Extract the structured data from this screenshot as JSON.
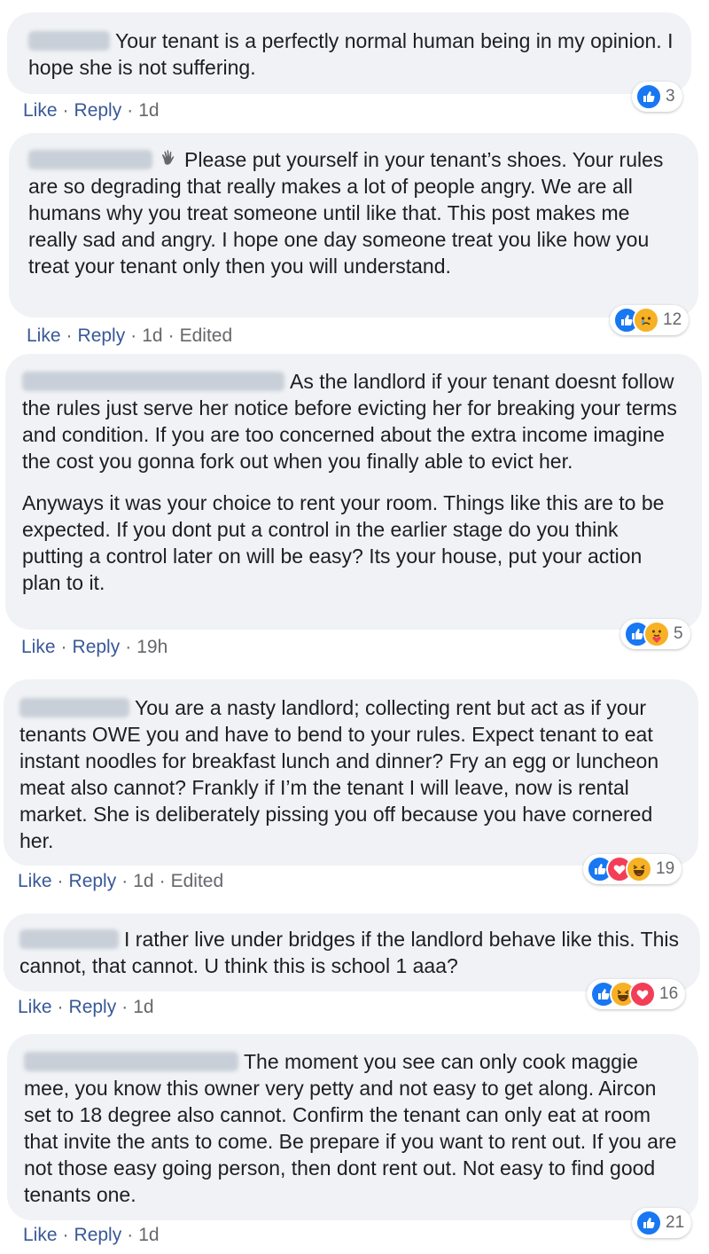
{
  "labels": {
    "like": "Like",
    "reply": "Reply",
    "edited": "Edited",
    "dot": "·"
  },
  "colors": {
    "bubble": "#f0f2f5",
    "link": "#385898",
    "meta": "#65676b",
    "like_blue": "#1877f2",
    "love_red": "#f33e58",
    "emoji_yellow": "#f7b125"
  },
  "comments": [
    {
      "author": "[blurred name]",
      "paragraphs": [
        "Your tenant is a perfectly normal human being in my opinion. I hope she is not suffering."
      ],
      "time": "1d",
      "reactions": [
        "like-icon"
      ],
      "reaction_count": "3"
    },
    {
      "author": "[blurred name]",
      "author_icon": "waving-hand-icon",
      "paragraphs": [
        "Please put yourself in your tenant’s shoes. Your rules are so degrading that really makes a lot of people angry. We are all humans why you treat someone until like that. This post makes me really sad and angry. I hope one day someone treat you like how you treat your tenant only then you will understand."
      ],
      "time": "1d",
      "edited": true,
      "reactions": [
        "like-icon",
        "sad-icon"
      ],
      "reaction_count": "12"
    },
    {
      "author": "[blurred name]",
      "paragraphs": [
        "As the landlord if your tenant doesnt follow the rules just serve her notice before evicting her for breaking your terms and condition. If you are too concerned about the extra income imagine the cost you gonna fork out when you finally able to evict her.",
        "Anyways it was your choice to rent your room. Things like this are to be expected. If you dont put a control in the earlier stage do you think putting a control later on will be easy? Its your house, put your action plan to it."
      ],
      "time": "19h",
      "reactions": [
        "like-icon",
        "care-icon"
      ],
      "reaction_count": "5"
    },
    {
      "author": "[blurred name]",
      "paragraphs": [
        "You are a nasty landlord; collecting rent but act as if your tenants OWE you and have to bend to your rules. Expect tenant to eat instant noodles for breakfast lunch and dinner? Fry an egg or luncheon meat also cannot? Frankly if I’m the tenant I will leave, now is rental market. She is deliberately pissing you off because you have cornered her."
      ],
      "time": "1d",
      "edited": true,
      "reactions": [
        "like-icon",
        "love-icon",
        "haha-icon"
      ],
      "reaction_count": "19"
    },
    {
      "author": "[blurred name]",
      "paragraphs": [
        "I rather live under bridges if the landlord behave like this. This cannot, that cannot. U think this is school 1 aaa?"
      ],
      "time": "1d",
      "reactions": [
        "like-icon",
        "haha-icon",
        "love-icon"
      ],
      "reaction_count": "16"
    },
    {
      "author": "[blurred name]",
      "paragraphs": [
        "The moment you see can only cook maggie mee, you know this owner very petty and not easy to get along. Aircon set to 18 degree also cannot. Confirm the tenant can only eat at room that invite the ants to come. Be prepare if you want to rent out. If you are not those easy going person, then dont rent out. Not easy to find good tenants one."
      ],
      "time": "1d",
      "reactions": [
        "like-icon"
      ],
      "reaction_count": "21"
    }
  ]
}
